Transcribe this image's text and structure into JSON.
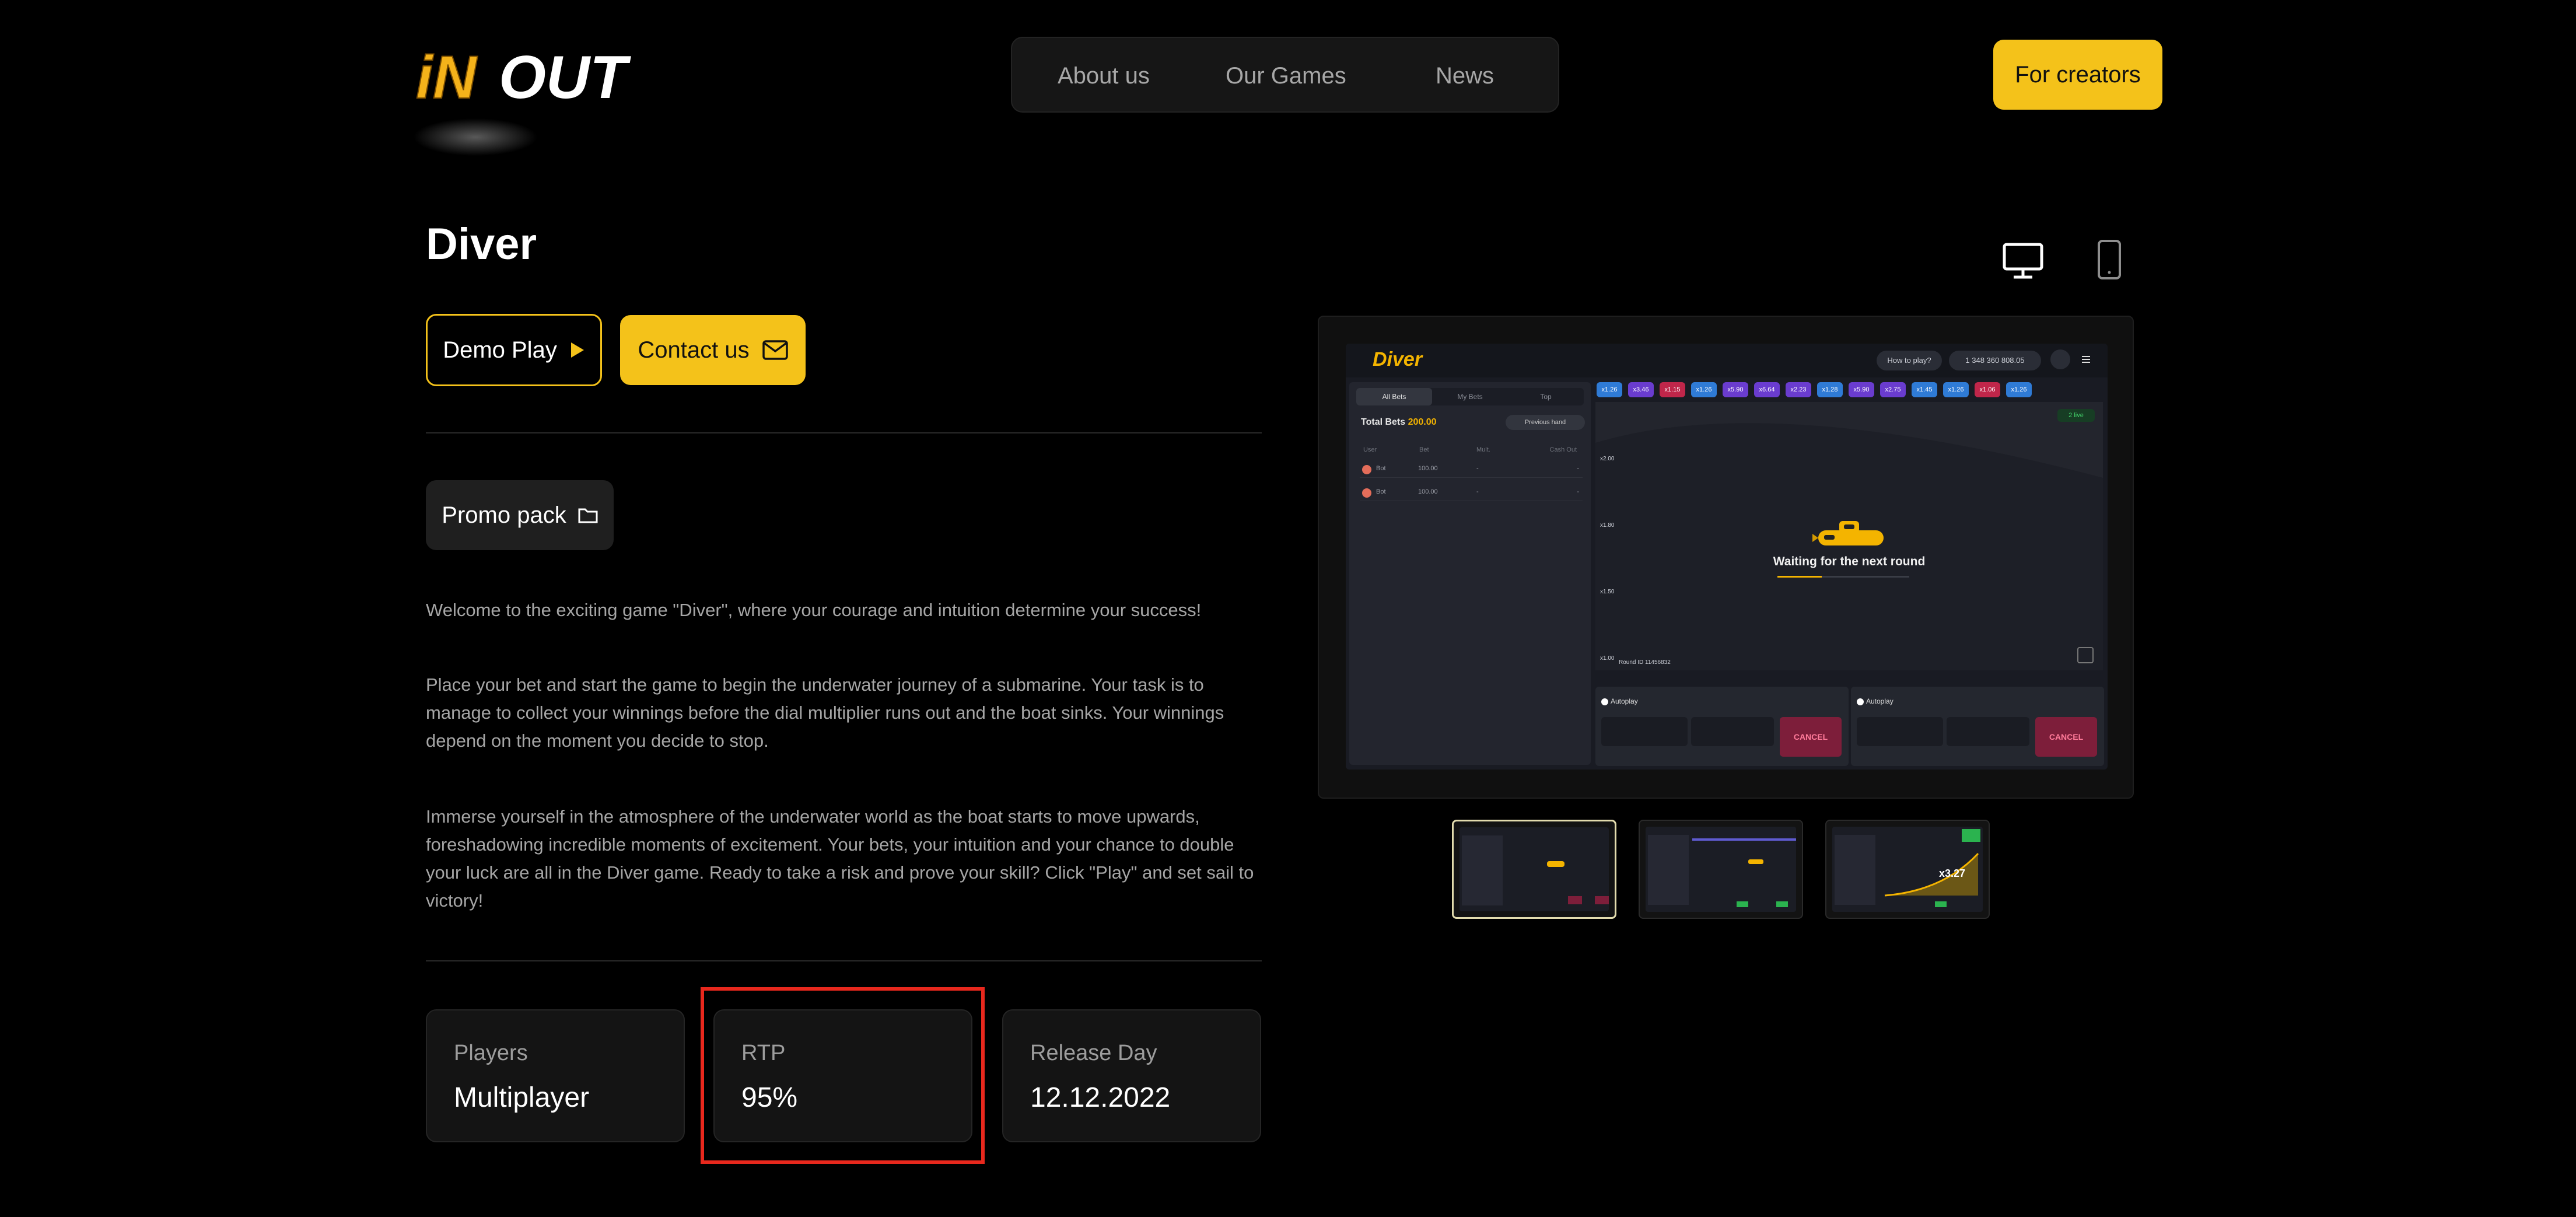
{
  "header": {
    "nav": [
      "About us",
      "Our Games",
      "News"
    ],
    "creators_button": "For creators",
    "brand_color": "#f4c21a"
  },
  "game": {
    "title": "Diver",
    "demo_button": "Demo Play",
    "contact_button": "Contact us",
    "promo_button": "Promo pack",
    "description": [
      "Welcome to the exciting game \"Diver\", where your courage and intuition determine your success!",
      "Place your bet and start the game to begin the underwater journey of a submarine. Your task is to manage to collect your winnings before the dial multiplier runs out and the boat sinks. Your winnings depend on the moment you decide to stop.",
      "Immerse yourself in the atmosphere of the underwater world as the boat starts to move upwards, foreshadowing incredible moments of excitement. Your bets, your intuition and your chance to double your luck are all in the Diver game. Ready to take a risk and prove your skill? Click \"Play\" and set sail to victory!"
    ],
    "stats": [
      {
        "label": "Players",
        "value": "Multiplayer"
      },
      {
        "label": "RTP",
        "value": "95%"
      },
      {
        "label": "Release Day",
        "value": "12.12.2022"
      }
    ],
    "highlighted_stat": "RTP"
  },
  "preview": {
    "device_icons": [
      "desktop-icon",
      "mobile-icon"
    ],
    "screen": {
      "logo": "Diver",
      "how_to_play": "How to play?",
      "balance": "1 348 360 808.05",
      "multipliers": [
        "x1.26",
        "x3.46",
        "x1.15",
        "x1.26",
        "x5.90",
        "x6.64",
        "x2.23",
        "x1.28",
        "x5.90",
        "x2.75",
        "x1.45",
        "x1.26",
        "x1.06",
        "x1.26"
      ],
      "tabs": [
        "All Bets",
        "My Bets",
        "Top"
      ],
      "total_bets_label": "Total Bets",
      "total_bets_value": "200.00",
      "previous_hand": "Previous hand",
      "columns": [
        "User",
        "Bet",
        "Mult.",
        "Cash Out"
      ],
      "bets": [
        {
          "user": "Bot",
          "bet": "100.00",
          "mult": "-",
          "cash": "-"
        },
        {
          "user": "Bot",
          "bet": "100.00",
          "mult": "-",
          "cash": "-"
        }
      ],
      "axis": [
        "x2.00",
        "x1.80",
        "x1.50",
        "x1.00"
      ],
      "waiting": "Waiting for the next round",
      "online": "2 live",
      "round": "Round ID 11456832",
      "autoplay": "Autoplay",
      "cancel": "CANCEL"
    },
    "thumb_multiplier": "x3.27"
  }
}
